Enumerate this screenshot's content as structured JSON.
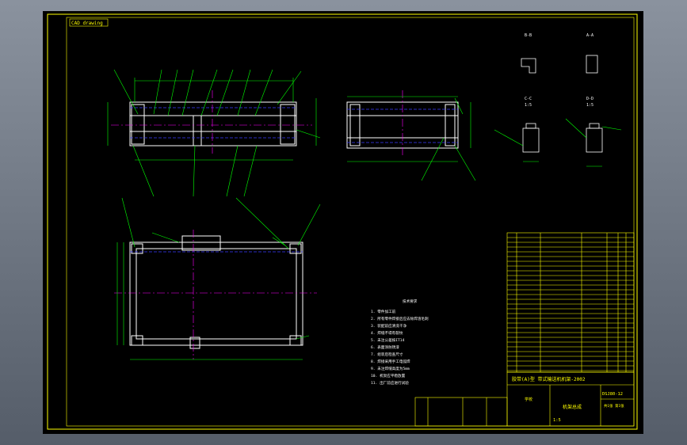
{
  "drawing": {
    "title_stamp": "CAD drawing",
    "frame_color": "#ffff00",
    "line_color": "#ffffff",
    "accent_colors": {
      "yellow": "#ffff00",
      "green": "#00ff00",
      "magenta": "#ff00ff",
      "blue": "#3a3aff",
      "cyan": "#00ffff",
      "red": "#ff3030"
    }
  },
  "views": {
    "section_labels": [
      "B-B",
      "A-A",
      "C-C",
      "D-D",
      "1:5",
      "1:5"
    ],
    "notes_title": "技术要求",
    "note_lines": [
      "1. 零件加工前",
      "2. 所有零件焊接后应去除焊渣毛刺",
      "3. 装配前应清洗干净",
      "4. 焊缝不得有裂纹",
      "5. 未注公差按IT14",
      "6. 表面涂防锈漆",
      "7. 组装后检查尺寸",
      "8. 焊接采用手工电弧焊",
      "9. 未注焊缝高度为5mm",
      "10. 机架应平稳放置",
      "11. 出厂前应进行试验"
    ]
  },
  "title_block": {
    "main_title": "胶带(A)型   带式输送机机架-2002",
    "part_name": "机架总成",
    "drawing_no": "DSJ80-12",
    "scale": "1:5",
    "label_school": "学校",
    "sheet_info": "共1张 第1张"
  }
}
